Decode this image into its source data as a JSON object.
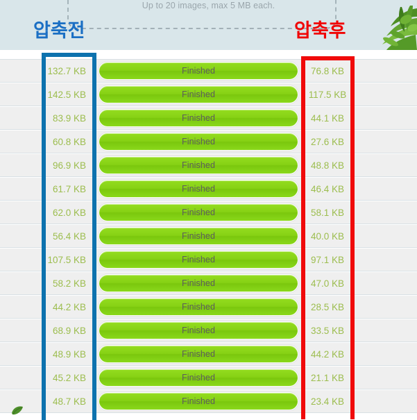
{
  "header": {
    "hint": "Up to 20 images, max 5 MB each.",
    "label_before": "압축전",
    "label_after": "압축후",
    "bg_color": "#d9e6ea",
    "blue_color": "#1b6fc4",
    "red_color": "#f00505",
    "plant_icon": "palm-plant-photo",
    "leader_icon": "dashed-connector-line"
  },
  "annotations": {
    "blue_box_color": "#0d72ae",
    "red_box_color": "#f00a0a"
  },
  "list": {
    "status_label": "Finished",
    "rows": [
      {
        "before": "132.7 KB",
        "after": "76.8 KB",
        "status": "Finished"
      },
      {
        "before": "142.5 KB",
        "after": "117.5 KB",
        "status": "Finished"
      },
      {
        "before": "83.9 KB",
        "after": "44.1 KB",
        "status": "Finished"
      },
      {
        "before": "60.8 KB",
        "after": "27.6 KB",
        "status": "Finished"
      },
      {
        "before": "96.9 KB",
        "after": "48.8 KB",
        "status": "Finished"
      },
      {
        "before": "61.7 KB",
        "after": "46.4 KB",
        "status": "Finished"
      },
      {
        "before": "62.0 KB",
        "after": "58.1 KB",
        "status": "Finished"
      },
      {
        "before": "56.4 KB",
        "after": "40.0 KB",
        "status": "Finished"
      },
      {
        "before": "107.5 KB",
        "after": "97.1 KB",
        "status": "Finished"
      },
      {
        "before": "58.2 KB",
        "after": "47.0 KB",
        "status": "Finished"
      },
      {
        "before": "44.2 KB",
        "after": "28.5 KB",
        "status": "Finished"
      },
      {
        "before": "68.9 KB",
        "after": "33.5 KB",
        "status": "Finished"
      },
      {
        "before": "48.9 KB",
        "after": "44.2 KB",
        "status": "Finished"
      },
      {
        "before": "45.2 KB",
        "after": "21.1 KB",
        "status": "Finished"
      },
      {
        "before": "48.7 KB",
        "after": "23.4 KB",
        "status": "Finished"
      }
    ]
  },
  "footer": {
    "leaf_icon": "green-leaf-icon"
  }
}
